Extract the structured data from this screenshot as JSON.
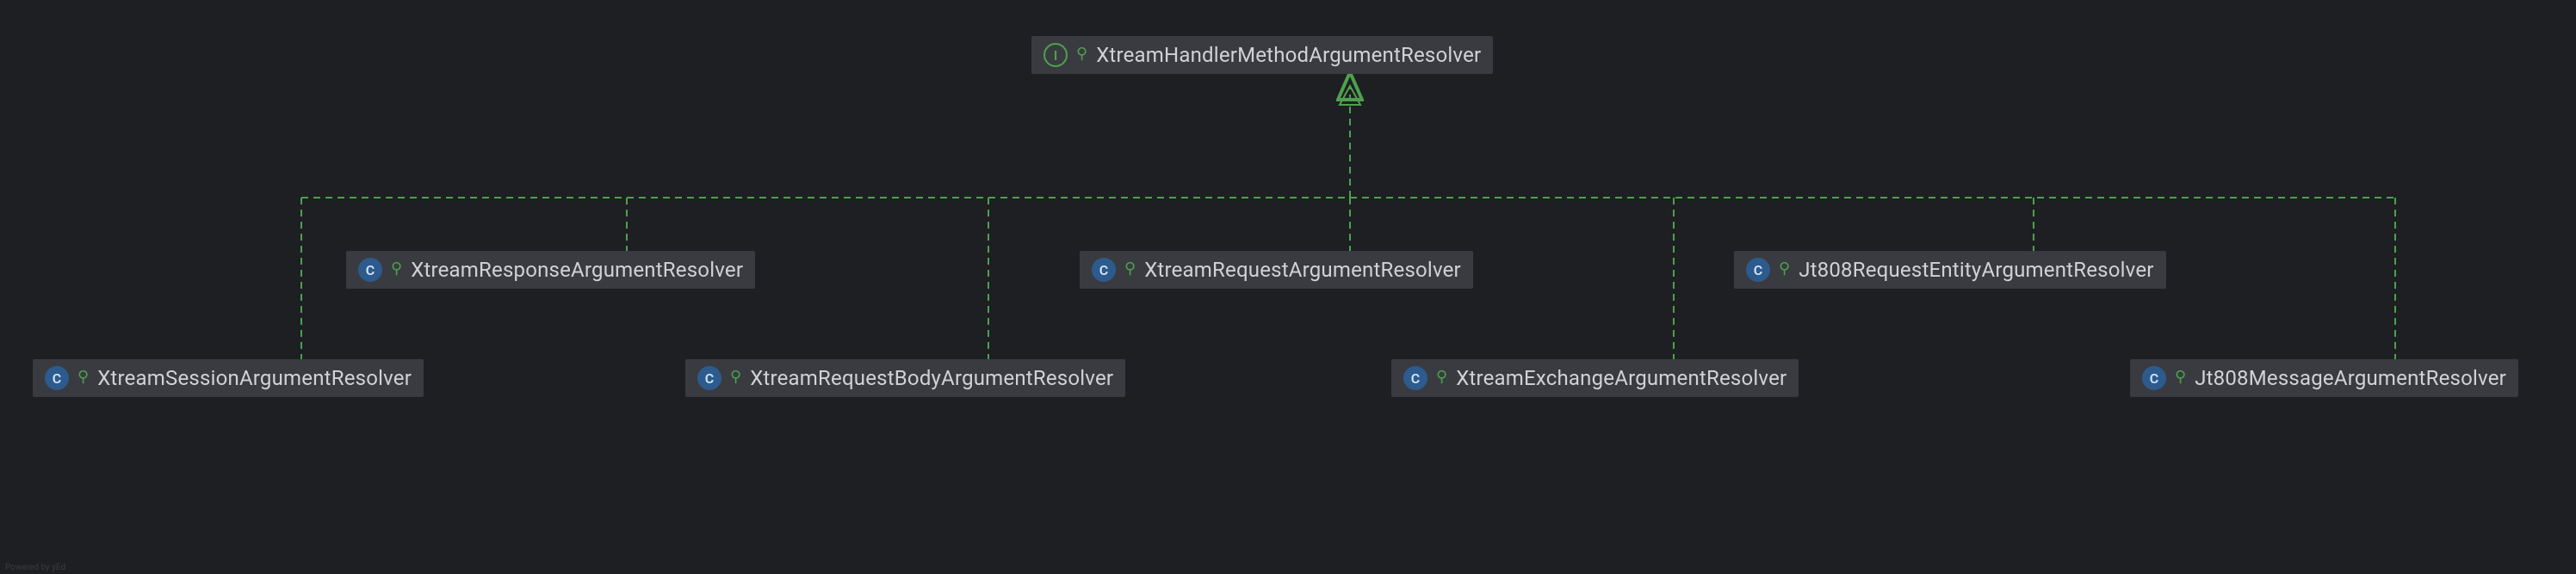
{
  "diagram": {
    "root": {
      "name": "XtreamHandlerMethodArgumentResolver",
      "kind": "interface",
      "kind_letter": "I"
    },
    "row_middle": [
      {
        "name": "XtreamResponseArgumentResolver",
        "kind": "class",
        "kind_letter": "C"
      },
      {
        "name": "XtreamRequestArgumentResolver",
        "kind": "class",
        "kind_letter": "C"
      },
      {
        "name": "Jt808RequestEntityArgumentResolver",
        "kind": "class",
        "kind_letter": "C"
      }
    ],
    "row_bottom": [
      {
        "name": "XtreamSessionArgumentResolver",
        "kind": "class",
        "kind_letter": "C"
      },
      {
        "name": "XtreamRequestBodyArgumentResolver",
        "kind": "class",
        "kind_letter": "C"
      },
      {
        "name": "XtreamExchangeArgumentResolver",
        "kind": "class",
        "kind_letter": "C"
      },
      {
        "name": "Jt808MessageArgumentResolver",
        "kind": "class",
        "kind_letter": "C"
      }
    ],
    "colors": {
      "background": "#1e1f22",
      "node_bg": "#393b40",
      "text": "#d0d2d6",
      "accent_green": "#4ea04e",
      "class_bg": "#2d5b8e"
    },
    "unlock_glyph": "⚲",
    "footer": "Powered by yEd"
  }
}
